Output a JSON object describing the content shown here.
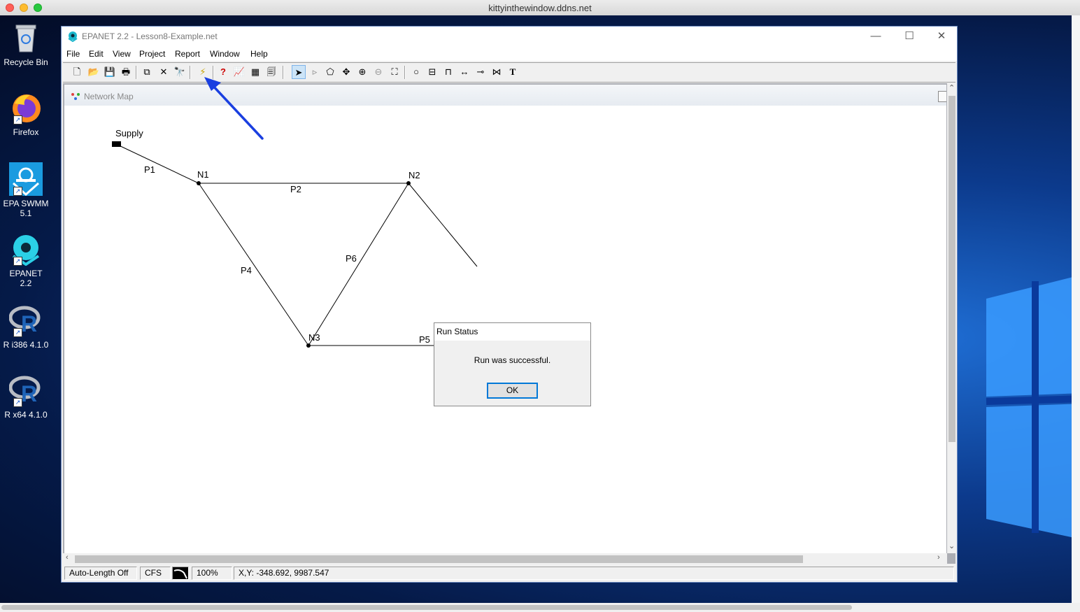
{
  "mac_window": {
    "title": "kittyinthewindow.ddns.net"
  },
  "desktop": {
    "icons": [
      {
        "label": "Recycle Bin",
        "icon": "recycle-bin-icon"
      },
      {
        "label": "Firefox",
        "icon": "firefox-icon"
      },
      {
        "label": "EPA SWMM\n5.1",
        "icon": "epa-swmm-icon"
      },
      {
        "label": "EPANET 2.2",
        "icon": "epanet-icon"
      },
      {
        "label": "R i386 4.1.0",
        "icon": "r-icon"
      },
      {
        "label": "R x64 4.1.0",
        "icon": "r-icon"
      }
    ]
  },
  "app": {
    "title": "EPANET 2.2 - Lesson8-Example.net",
    "window_controls": {
      "minimize": "—",
      "maximize": "☐",
      "close": "✕"
    },
    "menu": [
      "File",
      "Edit",
      "View",
      "Project",
      "Report",
      "Window",
      "Help"
    ],
    "toolbar": [
      {
        "name": "new-icon",
        "glyph": "🗋"
      },
      {
        "name": "open-icon",
        "glyph": "📂"
      },
      {
        "name": "save-icon",
        "glyph": "💾"
      },
      {
        "name": "print-icon",
        "glyph": "🖶"
      },
      {
        "name": "copy-icon",
        "glyph": "⧉"
      },
      {
        "name": "delete-icon",
        "glyph": "✕"
      },
      {
        "name": "find-icon",
        "glyph": "🔭"
      },
      {
        "name": "run-icon",
        "glyph": "⚡"
      },
      {
        "name": "query-icon",
        "glyph": "?"
      },
      {
        "name": "graph-icon",
        "glyph": "📈"
      },
      {
        "name": "table-icon",
        "glyph": "▦"
      },
      {
        "name": "options-icon",
        "glyph": "🗐"
      },
      {
        "name": "select-object-icon",
        "glyph": "➤"
      },
      {
        "name": "select-vertex-icon",
        "glyph": "▹"
      },
      {
        "name": "select-region-icon",
        "glyph": "⬠"
      },
      {
        "name": "pan-icon",
        "glyph": "✥"
      },
      {
        "name": "zoom-in-icon",
        "glyph": "⊕"
      },
      {
        "name": "zoom-out-icon",
        "glyph": "⊖"
      },
      {
        "name": "full-extent-icon",
        "glyph": "⛶"
      },
      {
        "name": "add-junction-icon",
        "glyph": "○"
      },
      {
        "name": "add-reservoir-icon",
        "glyph": "⊟"
      },
      {
        "name": "add-tank-icon",
        "glyph": "⊓"
      },
      {
        "name": "add-pipe-icon",
        "glyph": "↔"
      },
      {
        "name": "add-pump-icon",
        "glyph": "⊸"
      },
      {
        "name": "add-valve-icon",
        "glyph": "⋈"
      },
      {
        "name": "add-label-icon",
        "glyph": "T"
      }
    ],
    "map": {
      "title": "Network Map",
      "nodes": [
        {
          "id": "Supply"
        },
        {
          "id": "N1"
        },
        {
          "id": "N2"
        },
        {
          "id": "N3"
        }
      ],
      "links": [
        "P1",
        "P2",
        "P4",
        "P5",
        "P6"
      ]
    },
    "status": {
      "auto_length": "Auto-Length Off",
      "units": "CFS",
      "zoom": "100%",
      "coords": "X,Y: -348.692, 9987.547"
    }
  },
  "dialog": {
    "title": "Run Status",
    "message": "Run was successful.",
    "ok_label": "OK"
  },
  "colors": {
    "annotation_arrow": "#1a3fe0",
    "dialog_focus": "#0078d7"
  }
}
